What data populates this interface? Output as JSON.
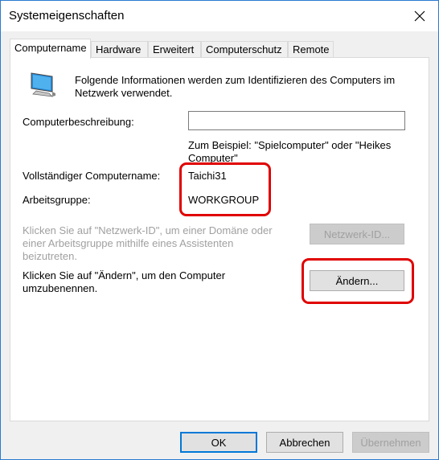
{
  "window": {
    "title": "Systemeigenschaften"
  },
  "tabs": [
    {
      "label": "Computername"
    },
    {
      "label": "Hardware"
    },
    {
      "label": "Erweitert"
    },
    {
      "label": "Computerschutz"
    },
    {
      "label": "Remote"
    }
  ],
  "panel": {
    "intro": "Folgende Informationen werden zum Identifizieren des Computers im Netzwerk verwendet.",
    "description_label": "Computerbeschreibung:",
    "description_value": "",
    "example_text": "Zum Beispiel: \"Spielcomputer\" oder \"Heikes Computer\"",
    "full_name_label": "Vollständiger Computername:",
    "full_name_value": "Taichi31",
    "workgroup_label": "Arbeitsgruppe:",
    "workgroup_value": "WORKGROUP",
    "network_id_text": "Klicken Sie auf \"Netzwerk-ID\", um einer Domäne oder einer Arbeitsgruppe mithilfe eines Assistenten beizutreten.",
    "network_id_button": "Netzwerk-ID...",
    "rename_text": "Klicken Sie auf \"Ändern\", um den Computer umzubenennen.",
    "change_button": "Ändern..."
  },
  "footer": {
    "ok": "OK",
    "cancel": "Abbrechen",
    "apply": "Übernehmen"
  },
  "colors": {
    "highlight_red": "#e00000",
    "focus_blue": "#0078d7"
  },
  "icons": {
    "computer": "computer-monitor-icon",
    "close": "close-icon"
  }
}
